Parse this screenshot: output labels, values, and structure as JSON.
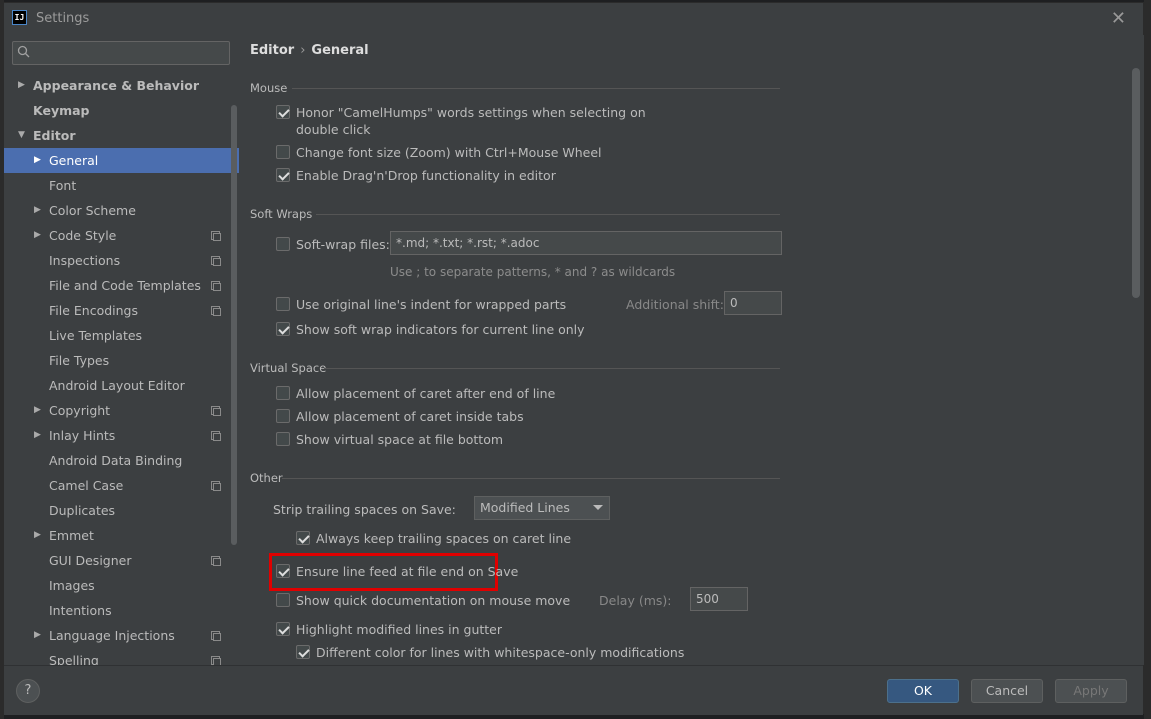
{
  "window": {
    "title": "Settings"
  },
  "search": {
    "placeholder": ""
  },
  "sidebar": {
    "items": [
      {
        "label": "Appearance & Behavior",
        "level": 0,
        "bold": true,
        "arrow": "collapsed"
      },
      {
        "label": "Keymap",
        "level": 0,
        "bold": true,
        "arrow": "none"
      },
      {
        "label": "Editor",
        "level": 0,
        "bold": true,
        "arrow": "expanded"
      },
      {
        "label": "General",
        "level": 1,
        "arrow": "collapsed",
        "selected": true
      },
      {
        "label": "Font",
        "level": 1,
        "arrow": "none"
      },
      {
        "label": "Color Scheme",
        "level": 1,
        "arrow": "collapsed"
      },
      {
        "label": "Code Style",
        "level": 1,
        "arrow": "collapsed",
        "project": true
      },
      {
        "label": "Inspections",
        "level": 1,
        "arrow": "none",
        "project": true
      },
      {
        "label": "File and Code Templates",
        "level": 1,
        "arrow": "none",
        "project": true
      },
      {
        "label": "File Encodings",
        "level": 1,
        "arrow": "none",
        "project": true
      },
      {
        "label": "Live Templates",
        "level": 1,
        "arrow": "none"
      },
      {
        "label": "File Types",
        "level": 1,
        "arrow": "none"
      },
      {
        "label": "Android Layout Editor",
        "level": 1,
        "arrow": "none"
      },
      {
        "label": "Copyright",
        "level": 1,
        "arrow": "collapsed",
        "project": true
      },
      {
        "label": "Inlay Hints",
        "level": 1,
        "arrow": "collapsed",
        "project": true
      },
      {
        "label": "Android Data Binding",
        "level": 1,
        "arrow": "none"
      },
      {
        "label": "Camel Case",
        "level": 1,
        "arrow": "none",
        "project": true
      },
      {
        "label": "Duplicates",
        "level": 1,
        "arrow": "none"
      },
      {
        "label": "Emmet",
        "level": 1,
        "arrow": "collapsed"
      },
      {
        "label": "GUI Designer",
        "level": 1,
        "arrow": "none",
        "project": true
      },
      {
        "label": "Images",
        "level": 1,
        "arrow": "none"
      },
      {
        "label": "Intentions",
        "level": 1,
        "arrow": "none"
      },
      {
        "label": "Language Injections",
        "level": 1,
        "arrow": "collapsed",
        "project": true
      },
      {
        "label": "Spelling",
        "level": 1,
        "arrow": "none",
        "project": true
      }
    ]
  },
  "breadcrumb": {
    "parent": "Editor",
    "separator": "›",
    "current": "General"
  },
  "sections": {
    "mouse": {
      "title": "Mouse",
      "camel_humps_line1": "Honor \"CamelHumps\" words settings when selecting on",
      "camel_humps_line2": "double click",
      "camel_humps_checked": true,
      "zoom_label": "Change font size (Zoom) with Ctrl+Mouse Wheel",
      "zoom_checked": false,
      "dragdrop_label": "Enable Drag'n'Drop functionality in editor",
      "dragdrop_checked": true
    },
    "soft_wraps": {
      "title": "Soft Wraps",
      "softwrap_label": "Soft-wrap files:",
      "softwrap_checked": false,
      "softwrap_value": "*.md; *.txt; *.rst; *.adoc",
      "softwrap_hint": "Use ; to separate patterns, * and ? as wildcards",
      "indent_label": "Use original line's indent for wrapped parts",
      "indent_checked": false,
      "additional_shift_label": "Additional shift:",
      "additional_shift_value": "0",
      "indicators_label": "Show soft wrap indicators for current line only",
      "indicators_checked": true
    },
    "virtual_space": {
      "title": "Virtual Space",
      "after_eol_label": "Allow placement of caret after end of line",
      "after_eol_checked": false,
      "inside_tabs_label": "Allow placement of caret inside tabs",
      "inside_tabs_checked": false,
      "file_bottom_label": "Show virtual space at file bottom",
      "file_bottom_checked": false
    },
    "other": {
      "title": "Other",
      "strip_label": "Strip trailing spaces on Save:",
      "strip_value": "Modified Lines",
      "keep_trailing_label": "Always keep trailing spaces on caret line",
      "keep_trailing_checked": true,
      "line_feed_label": "Ensure line feed at file end on Save",
      "line_feed_checked": true,
      "quick_doc_label": "Show quick documentation on mouse move",
      "quick_doc_checked": false,
      "delay_label": "Delay (ms):",
      "delay_value": "500",
      "highlight_label": "Highlight modified lines in gutter",
      "highlight_checked": true,
      "whitespace_label": "Different color for lines with whitespace-only modifications",
      "whitespace_checked": true
    }
  },
  "footer": {
    "help": "?",
    "ok": "OK",
    "cancel": "Cancel",
    "apply": "Apply"
  },
  "colors": {
    "selection": "#4b6eaf",
    "panel": "#3c3f41",
    "primary_button": "#365880",
    "highlight_box": "#e00000"
  }
}
